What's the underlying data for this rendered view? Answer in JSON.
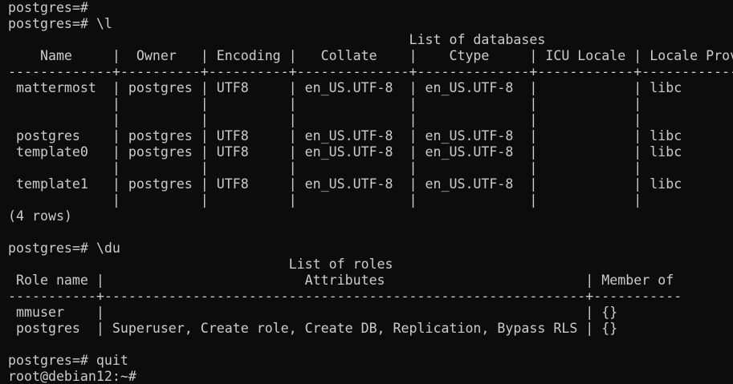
{
  "terminal": {
    "lines": [
      "postgres=#",
      "postgres=# \\l",
      "                                                  List of databases",
      "    Name     |  Owner   | Encoding |   Collate    |    Ctype     | ICU Locale | Locale Provider | Access privileges",
      "-------------+----------+----------+--------------+--------------+------------+-----------------+-------------------",
      " mattermost  | postgres | UTF8     | en_US.UTF-8  | en_US.UTF-8  |            | libc            |",
      "             |          |          |              |              |            |                 |",
      "             |          |          |              |              |            |                 |",
      " postgres    | postgres | UTF8     | en_US.UTF-8  | en_US.UTF-8  |            | libc            |",
      " template0   | postgres | UTF8     | en_US.UTF-8  | en_US.UTF-8  |            | libc            |",
      "             |          |          |              |              |            |                 |",
      " template1   | postgres | UTF8     | en_US.UTF-8  | en_US.UTF-8  |            | libc            |",
      "             |          |          |              |              |            |                 |",
      "(4 rows)",
      "",
      "postgres=# \\du",
      "                                   List of roles",
      " Role name |                         Attributes                         | Member of",
      "-----------+------------------------------------------------------------+-----------",
      " mmuser    |                                                            | {}",
      " postgres  | Superuser, Create role, Create DB, Replication, Bypass RLS | {}",
      "",
      "postgres=# quit",
      "root@debian12:~#"
    ]
  }
}
